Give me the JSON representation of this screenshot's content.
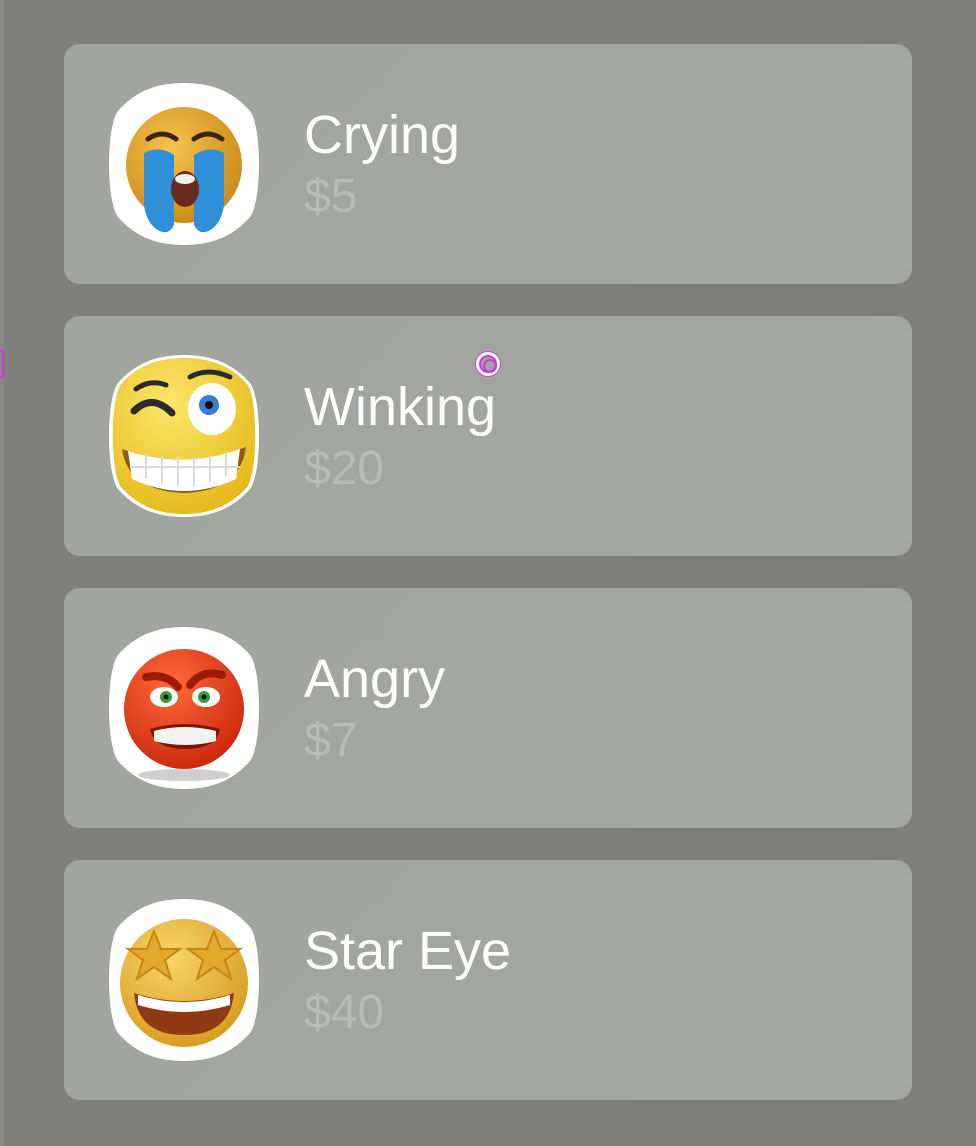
{
  "products": [
    {
      "name": "Crying",
      "price": "$5",
      "icon": "crying-face-icon"
    },
    {
      "name": "Winking",
      "price": "$20",
      "icon": "winking-face-icon"
    },
    {
      "name": "Angry",
      "price": "$7",
      "icon": "angry-face-icon"
    },
    {
      "name": "Star Eye",
      "price": "$40",
      "icon": "star-eyes-face-icon"
    }
  ],
  "colors": {
    "background": "#7f807d",
    "card": "#a2a5a0",
    "name_text": "#ffffff",
    "price_text": "#b8bbb6",
    "cursor_accent": "#d23ad6"
  }
}
